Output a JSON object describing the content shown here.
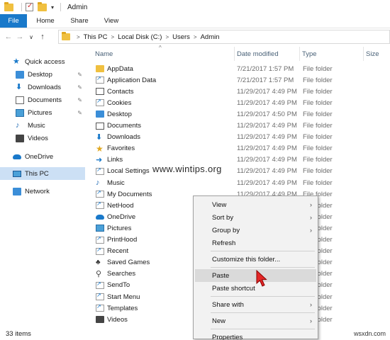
{
  "window": {
    "title": "Admin"
  },
  "ribbon": {
    "tabs": [
      "File",
      "Home",
      "Share",
      "View"
    ]
  },
  "address": {
    "crumbs": [
      "This PC",
      "Local Disk (C:)",
      "Users",
      "Admin"
    ]
  },
  "navpane": {
    "items": [
      {
        "label": "Quick access",
        "icon": "star-icon"
      },
      {
        "label": "Desktop",
        "icon": "desktop-icon",
        "pinned": true
      },
      {
        "label": "Downloads",
        "icon": "downloads-icon",
        "pinned": true
      },
      {
        "label": "Documents",
        "icon": "documents-icon",
        "pinned": true
      },
      {
        "label": "Pictures",
        "icon": "pictures-icon",
        "pinned": true
      },
      {
        "label": "Music",
        "icon": "music-icon"
      },
      {
        "label": "Videos",
        "icon": "videos-icon"
      },
      {
        "label": "OneDrive",
        "icon": "onedrive-icon"
      },
      {
        "label": "This PC",
        "icon": "pc-icon",
        "selected": true
      },
      {
        "label": "Network",
        "icon": "network-icon"
      }
    ]
  },
  "columns": {
    "name": "Name",
    "date": "Date modified",
    "type": "Type",
    "size": "Size"
  },
  "files": [
    {
      "name": "AppData",
      "date": "7/21/2017 1:57 PM",
      "type": "File folder",
      "icon": "folder-icon"
    },
    {
      "name": "Application Data",
      "date": "7/21/2017 1:57 PM",
      "type": "File folder",
      "icon": "shortcut-folder-icon"
    },
    {
      "name": "Contacts",
      "date": "11/29/2017 4:49 PM",
      "type": "File folder",
      "icon": "contacts-icon"
    },
    {
      "name": "Cookies",
      "date": "11/29/2017 4:49 PM",
      "type": "File folder",
      "icon": "shortcut-folder-icon"
    },
    {
      "name": "Desktop",
      "date": "11/29/2017 4:50 PM",
      "type": "File folder",
      "icon": "desktop-icon"
    },
    {
      "name": "Documents",
      "date": "11/29/2017 4:49 PM",
      "type": "File folder",
      "icon": "documents-icon"
    },
    {
      "name": "Downloads",
      "date": "11/29/2017 4:49 PM",
      "type": "File folder",
      "icon": "downloads-icon"
    },
    {
      "name": "Favorites",
      "date": "11/29/2017 4:49 PM",
      "type": "File folder",
      "icon": "favorites-icon"
    },
    {
      "name": "Links",
      "date": "11/29/2017 4:49 PM",
      "type": "File folder",
      "icon": "links-icon"
    },
    {
      "name": "Local Settings",
      "date": "11/29/2017 4:49 PM",
      "type": "File folder",
      "icon": "shortcut-folder-icon"
    },
    {
      "name": "Music",
      "date": "11/29/2017 4:49 PM",
      "type": "File folder",
      "icon": "music-icon"
    },
    {
      "name": "My Documents",
      "date": "11/29/2017 4:49 PM",
      "type": "File folder",
      "icon": "shortcut-folder-icon"
    },
    {
      "name": "NetHood",
      "date": "",
      "type": "File folder",
      "icon": "shortcut-folder-icon"
    },
    {
      "name": "OneDrive",
      "date": "",
      "type": "File folder",
      "icon": "onedrive-icon"
    },
    {
      "name": "Pictures",
      "date": "",
      "type": "File folder",
      "icon": "pictures-icon"
    },
    {
      "name": "PrintHood",
      "date": "",
      "type": "File folder",
      "icon": "shortcut-folder-icon"
    },
    {
      "name": "Recent",
      "date": "",
      "type": "File folder",
      "icon": "shortcut-folder-icon"
    },
    {
      "name": "Saved Games",
      "date": "",
      "type": "File folder",
      "icon": "saved-games-icon"
    },
    {
      "name": "Searches",
      "date": "",
      "type": "File folder",
      "icon": "searches-icon"
    },
    {
      "name": "SendTo",
      "date": "",
      "type": "File folder",
      "icon": "shortcut-folder-icon"
    },
    {
      "name": "Start Menu",
      "date": "",
      "type": "File folder",
      "icon": "shortcut-folder-icon"
    },
    {
      "name": "Templates",
      "date": "",
      "type": "File folder",
      "icon": "shortcut-folder-icon"
    },
    {
      "name": "Videos",
      "date": "",
      "type": "File folder",
      "icon": "videos-icon"
    }
  ],
  "context_menu": {
    "items": [
      {
        "label": "View",
        "submenu": true
      },
      {
        "label": "Sort by",
        "submenu": true
      },
      {
        "label": "Group by",
        "submenu": true
      },
      {
        "label": "Refresh",
        "submenu": false
      },
      {
        "separator": true
      },
      {
        "label": "Customize this folder...",
        "submenu": false
      },
      {
        "separator": true
      },
      {
        "label": "Paste",
        "submenu": false,
        "highlighted": true
      },
      {
        "label": "Paste shortcut",
        "submenu": false
      },
      {
        "separator": true
      },
      {
        "label": "Share with",
        "submenu": true
      },
      {
        "separator": true
      },
      {
        "label": "New",
        "submenu": true
      },
      {
        "separator": true
      },
      {
        "label": "Properties",
        "submenu": false
      }
    ]
  },
  "status": {
    "item_count": "33 items"
  },
  "watermark": "www.wintips.org",
  "brand": "wsxdn.com",
  "colors": {
    "accent": "#1979ca",
    "selected": "#cce0f5",
    "folder": "#f0c040"
  }
}
